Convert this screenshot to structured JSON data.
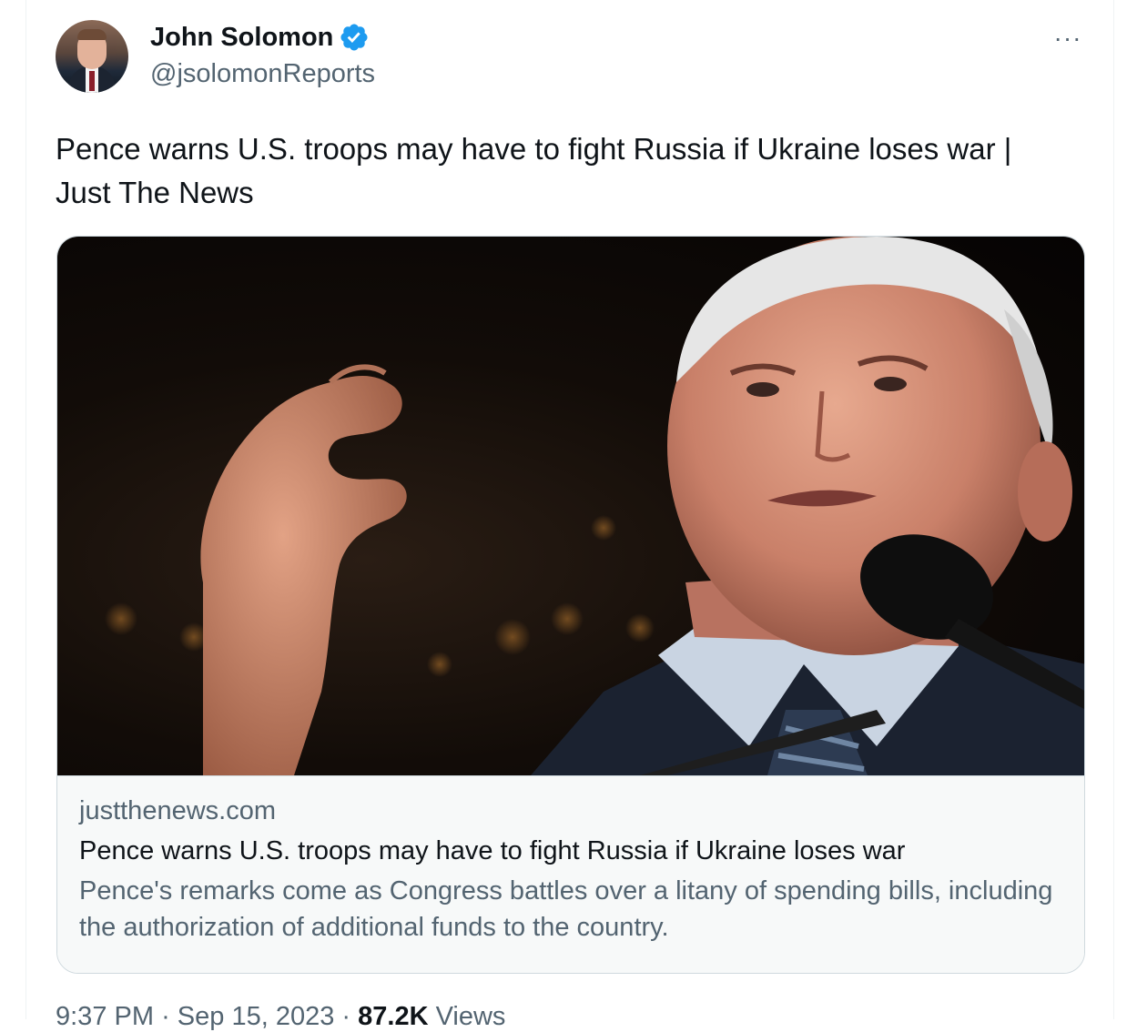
{
  "author": {
    "display_name": "John Solomon",
    "handle": "@jsolomonReports",
    "verified_icon": "verified-badge-icon"
  },
  "more_menu_label": "···",
  "tweet": {
    "text": "Pence warns U.S. troops may have to fight Russia if Ukraine loses war  | Just The News"
  },
  "link_card": {
    "domain": "justthenews.com",
    "title": "Pence warns U.S. troops may have to fight Russia if Ukraine loses war",
    "description": "Pence's remarks come as Congress battles over a litany of spending bills, including the authorization of additional funds to the country."
  },
  "footer": {
    "time": "9:37 PM",
    "separator": "·",
    "date": "Sep 15, 2023",
    "views_count": "87.2K",
    "views_label": "Views"
  },
  "colors": {
    "verified_blue": "#1d9bf0",
    "secondary_text": "#536471",
    "primary_text": "#0f1419",
    "card_border": "#cfd9de"
  }
}
